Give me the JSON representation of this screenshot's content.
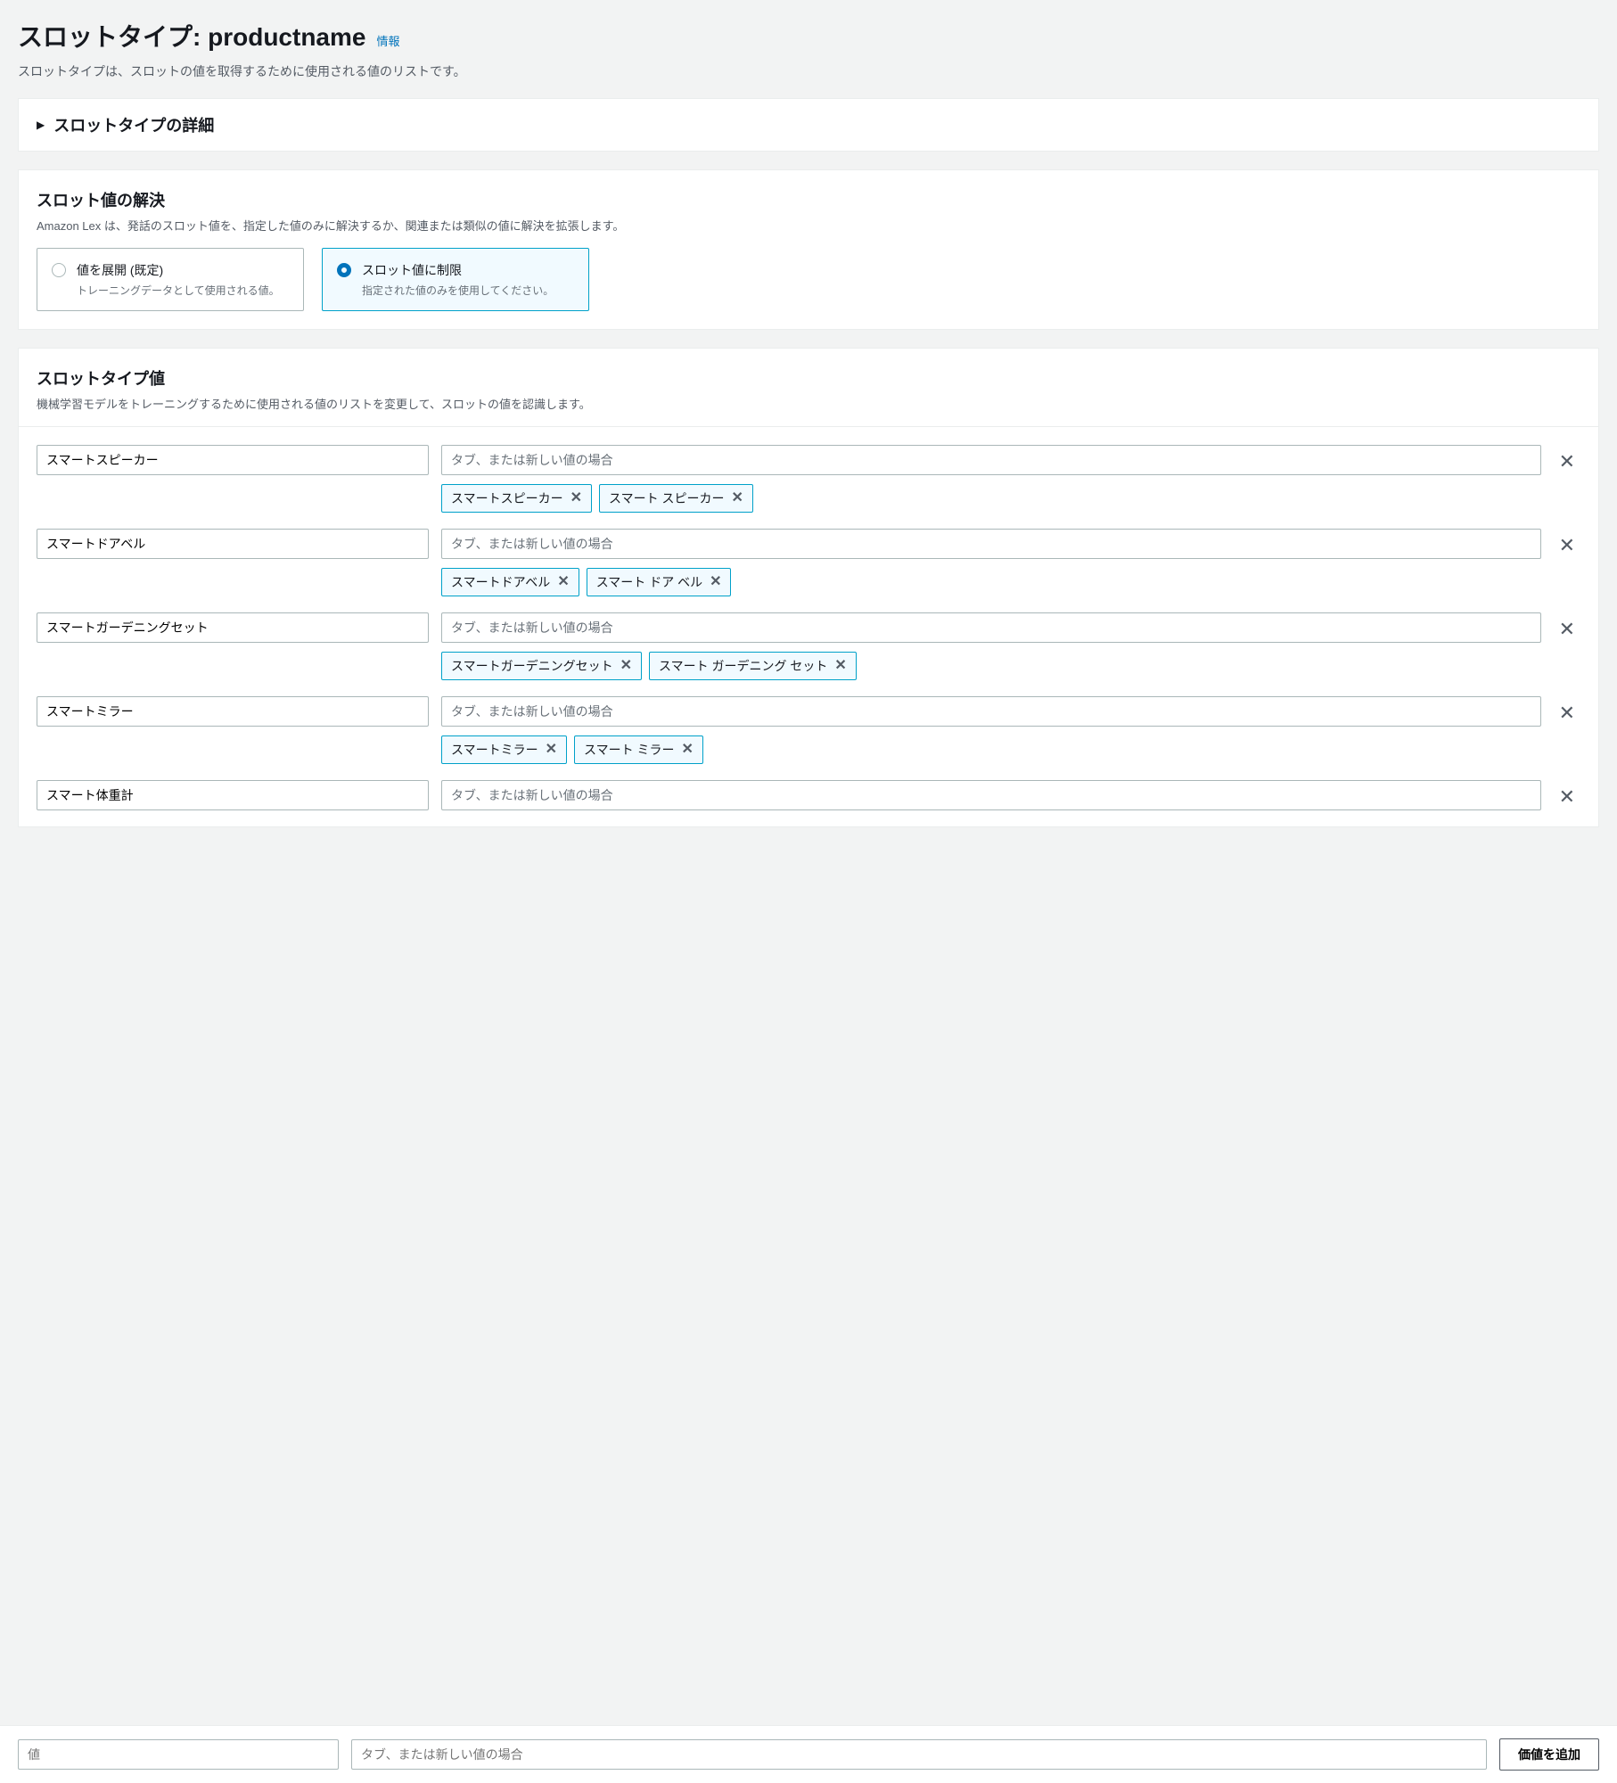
{
  "page": {
    "title_prefix": "スロットタイプ: ",
    "title_name": "productname",
    "info_label": "情報",
    "description": "スロットタイプは、スロットの値を取得するために使用される値のリストです。"
  },
  "details_panel": {
    "title": "スロットタイプの詳細"
  },
  "resolution_panel": {
    "title": "スロット値の解決",
    "subtitle": "Amazon Lex は、発話のスロット値を、指定した値のみに解決するか、関連または類似の値に解決を拡張します。",
    "options": [
      {
        "label": "値を展開 (既定)",
        "desc": "トレーニングデータとして使用される値。",
        "selected": false
      },
      {
        "label": "スロット値に制限",
        "desc": "指定された値のみを使用してください。",
        "selected": true
      }
    ]
  },
  "values_panel": {
    "title": "スロットタイプ値",
    "subtitle": "機械学習モデルをトレーニングするために使用される値のリストを変更して、スロットの値を認識します。",
    "synonym_placeholder": "タブ、または新しい値の場合",
    "rows": [
      {
        "value": "スマートスピーカー",
        "synonyms": [
          "スマートスピーカー",
          "スマート スピーカー"
        ]
      },
      {
        "value": "スマートドアベル",
        "synonyms": [
          "スマートドアベル",
          "スマート ドア ベル"
        ]
      },
      {
        "value": "スマートガーデニングセット",
        "synonyms": [
          "スマートガーデニングセット",
          "スマート ガーデニング セット"
        ]
      },
      {
        "value": "スマートミラー",
        "synonyms": [
          "スマートミラー",
          "スマート ミラー"
        ]
      },
      {
        "value": "スマート体重計",
        "synonyms": []
      }
    ]
  },
  "bottom_bar": {
    "value_placeholder": "値",
    "synonym_placeholder": "タブ、または新しい値の場合",
    "add_label": "価値を追加"
  }
}
